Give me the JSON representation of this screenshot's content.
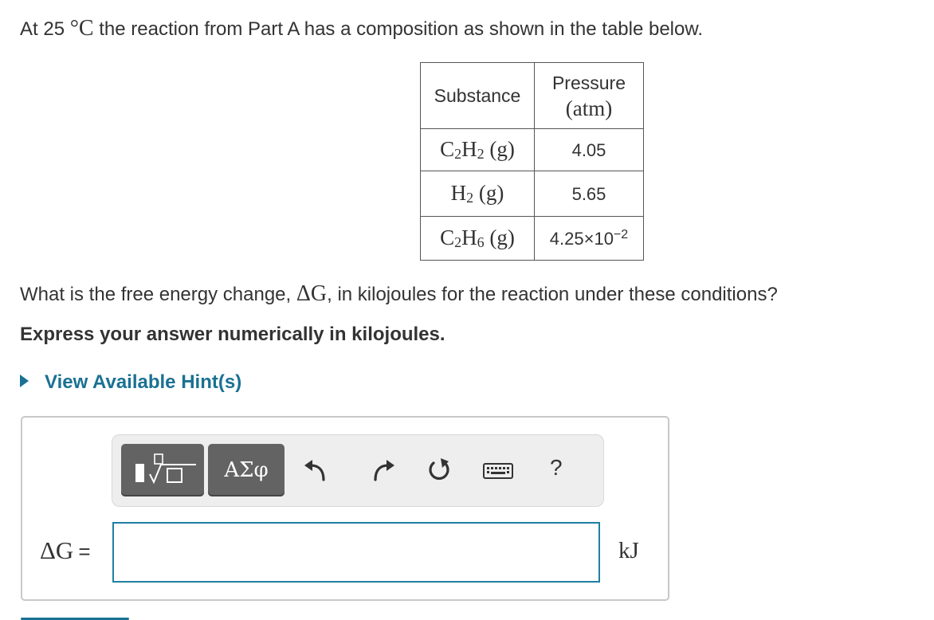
{
  "intro": {
    "prefix": "At 25",
    "unit": "°C",
    "suffix": " the reaction from Part A has a composition as shown in the table below."
  },
  "table": {
    "headers": {
      "substance": "Substance",
      "pressure": "Pressure",
      "pressure_unit": "(atm)"
    },
    "rows": [
      {
        "formula": [
          "C",
          "2",
          "H",
          "2",
          " (g)"
        ],
        "value": "4.05",
        "exp": ""
      },
      {
        "formula": [
          "H",
          "2",
          " (g)",
          "",
          ""
        ],
        "value": "5.65",
        "exp": ""
      },
      {
        "formula": [
          "C",
          "2",
          "H",
          "6",
          " (g)"
        ],
        "value": "4.25×10",
        "exp": "−2"
      }
    ]
  },
  "question": {
    "prefix": "What is the free energy change, ",
    "symbol": "ΔG",
    "suffix": ", in kilojoules for the reaction under these conditions?"
  },
  "instruction": "Express your answer numerically in kilojoules.",
  "hint_link": "View Available Hint(s)",
  "toolbar": {
    "greek_label": "ΑΣφ",
    "help_label": "?",
    "icons": [
      "templates-icon",
      "greek-letters-icon",
      "undo-icon",
      "redo-icon",
      "reset-icon",
      "keyboard-icon",
      "help-icon"
    ]
  },
  "answer": {
    "label": "ΔG",
    "equals": "=",
    "value": "",
    "unit": "kJ"
  },
  "colors": {
    "link": "#1a7193",
    "input_border": "#1f7fa3",
    "button_bg": "#636363"
  }
}
